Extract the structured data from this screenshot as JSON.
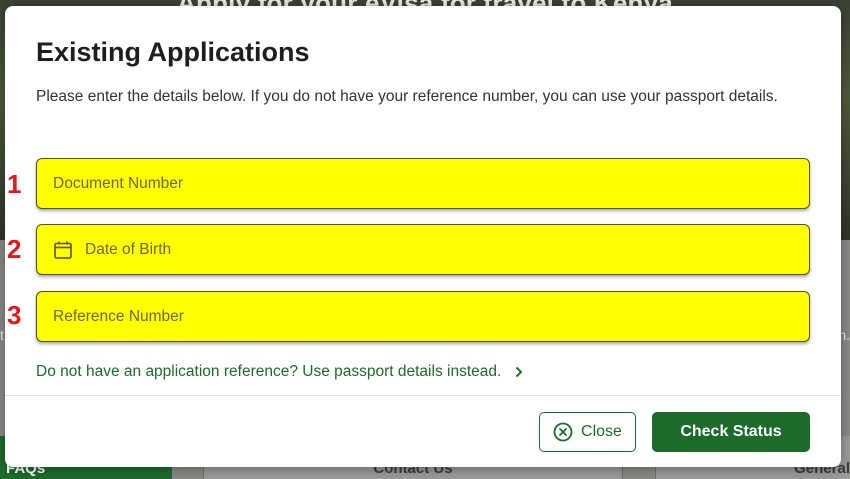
{
  "background": {
    "hero_title": "Apply for your eVisa for travel to Kenya",
    "tabs": {
      "faqs": "FAQs",
      "contact": "Contact Us",
      "general": "General"
    },
    "edge_left": "t",
    "edge_right": "h."
  },
  "modal": {
    "title": "Existing Applications",
    "description": "Please enter the details below. If you do not have your reference number, you can use your passport details.",
    "fields": {
      "document_number": {
        "placeholder": "Document Number",
        "marker": "1"
      },
      "date_of_birth": {
        "placeholder": "Date of Birth",
        "marker": "2",
        "icon": "calendar-icon"
      },
      "reference_number": {
        "placeholder": "Reference Number",
        "marker": "3"
      }
    },
    "passport_link": "Do not have an application reference? Use passport details instead.",
    "buttons": {
      "close": "Close",
      "check_status": "Check Status"
    }
  },
  "colors": {
    "brand_green": "#1c6b2a",
    "highlight": "#ffff00",
    "marker_red": "#e0191f"
  }
}
